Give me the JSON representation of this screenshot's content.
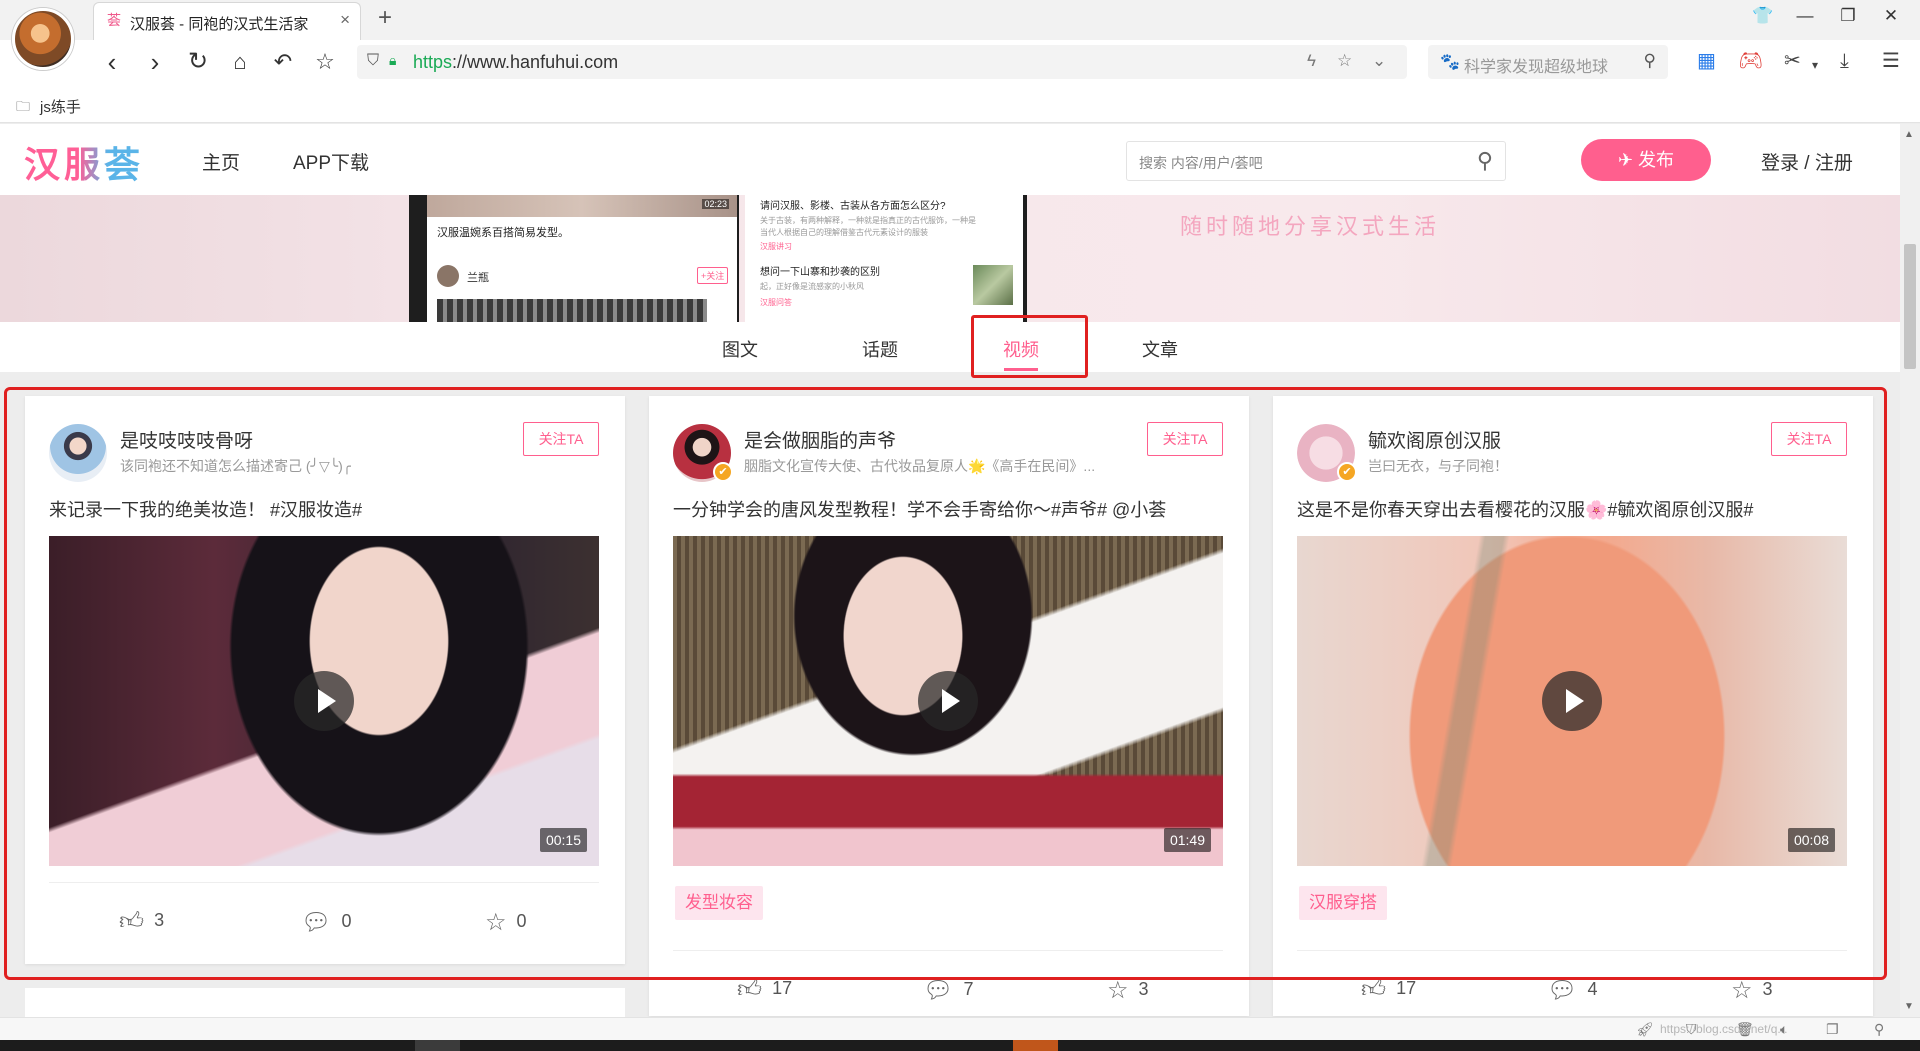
{
  "browser": {
    "tab_title": "汉服荟 - 同袍的汉式生活家",
    "tab_favicon": "荟",
    "url_scheme": "https",
    "url_rest": "://www.hanfuhui.com",
    "search_placeholder": "科学家发现超级地球",
    "bookmark": "js练手"
  },
  "site": {
    "logo": "汉服荟",
    "nav": [
      "主页",
      "APP下载"
    ],
    "search_placeholder": "搜索 内容/用户/荟吧",
    "publish": "发布",
    "login": "登录 / 注册"
  },
  "banner": {
    "phone_caption": "汉服温婉系百搭简易发型。",
    "phone_user": "兰瓶",
    "phone_follow": "+关注",
    "right_lines": [
      "请问汉服、影楼、古装从各方面怎么区分?",
      "想问一下山寨和抄袭的区别"
    ],
    "right_subs": [
      "关于古装，有两种解释，一种就是指真正的古代服饰，一种是",
      "当代人根据自己的理解借鉴古代元素设计的服装",
      "起，正好像是流感家的小秋风"
    ],
    "right_tag1": "汉服讲习",
    "right_tag2": "汉服问答",
    "slogan": "随时随地分享汉式生活",
    "phone_time": "02:23"
  },
  "tabs": [
    {
      "label": "图文",
      "active": false
    },
    {
      "label": "话题",
      "active": false
    },
    {
      "label": "视频",
      "active": true
    },
    {
      "label": "文章",
      "active": false
    }
  ],
  "posts": [
    {
      "name": "是吱吱吱吱骨呀",
      "bio": "该同袍还不知道怎么描述寄己 (╯▽╰)╭",
      "follow": "关注TA",
      "text": "来记录一下我的绝美妆造！ #汉服妆造#",
      "duration": "00:15",
      "tag": "",
      "likes": "3",
      "comments": "0",
      "stars": "0",
      "verified": false
    },
    {
      "name": "是会做胭脂的声爷",
      "bio": "胭脂文化宣传大使、古代妆品复原人🌟《高手在民间》...",
      "follow": "关注TA",
      "text": "一分钟学会的唐风发型教程！学不会手寄给你～#声爷# @小荟",
      "duration": "01:49",
      "tag": "发型妆容",
      "likes": "17",
      "comments": "7",
      "stars": "3",
      "verified": true
    },
    {
      "name": "毓欢阁原创汉服",
      "bio": "岂曰无衣，与子同袍！",
      "follow": "关注TA",
      "text": "这是不是你春天穿出去看樱花的汉服🌸#毓欢阁原创汉服#",
      "duration": "00:08",
      "tag": "汉服穿搭",
      "likes": "17",
      "comments": "4",
      "stars": "3",
      "verified": true
    }
  ],
  "status": {
    "watermark": "https://blog.csdn.net/q..."
  },
  "colors": {
    "brand_pink": "#ff5f8e",
    "highlight_red": "#e02020",
    "logo_blue": "#5ab4e8"
  }
}
